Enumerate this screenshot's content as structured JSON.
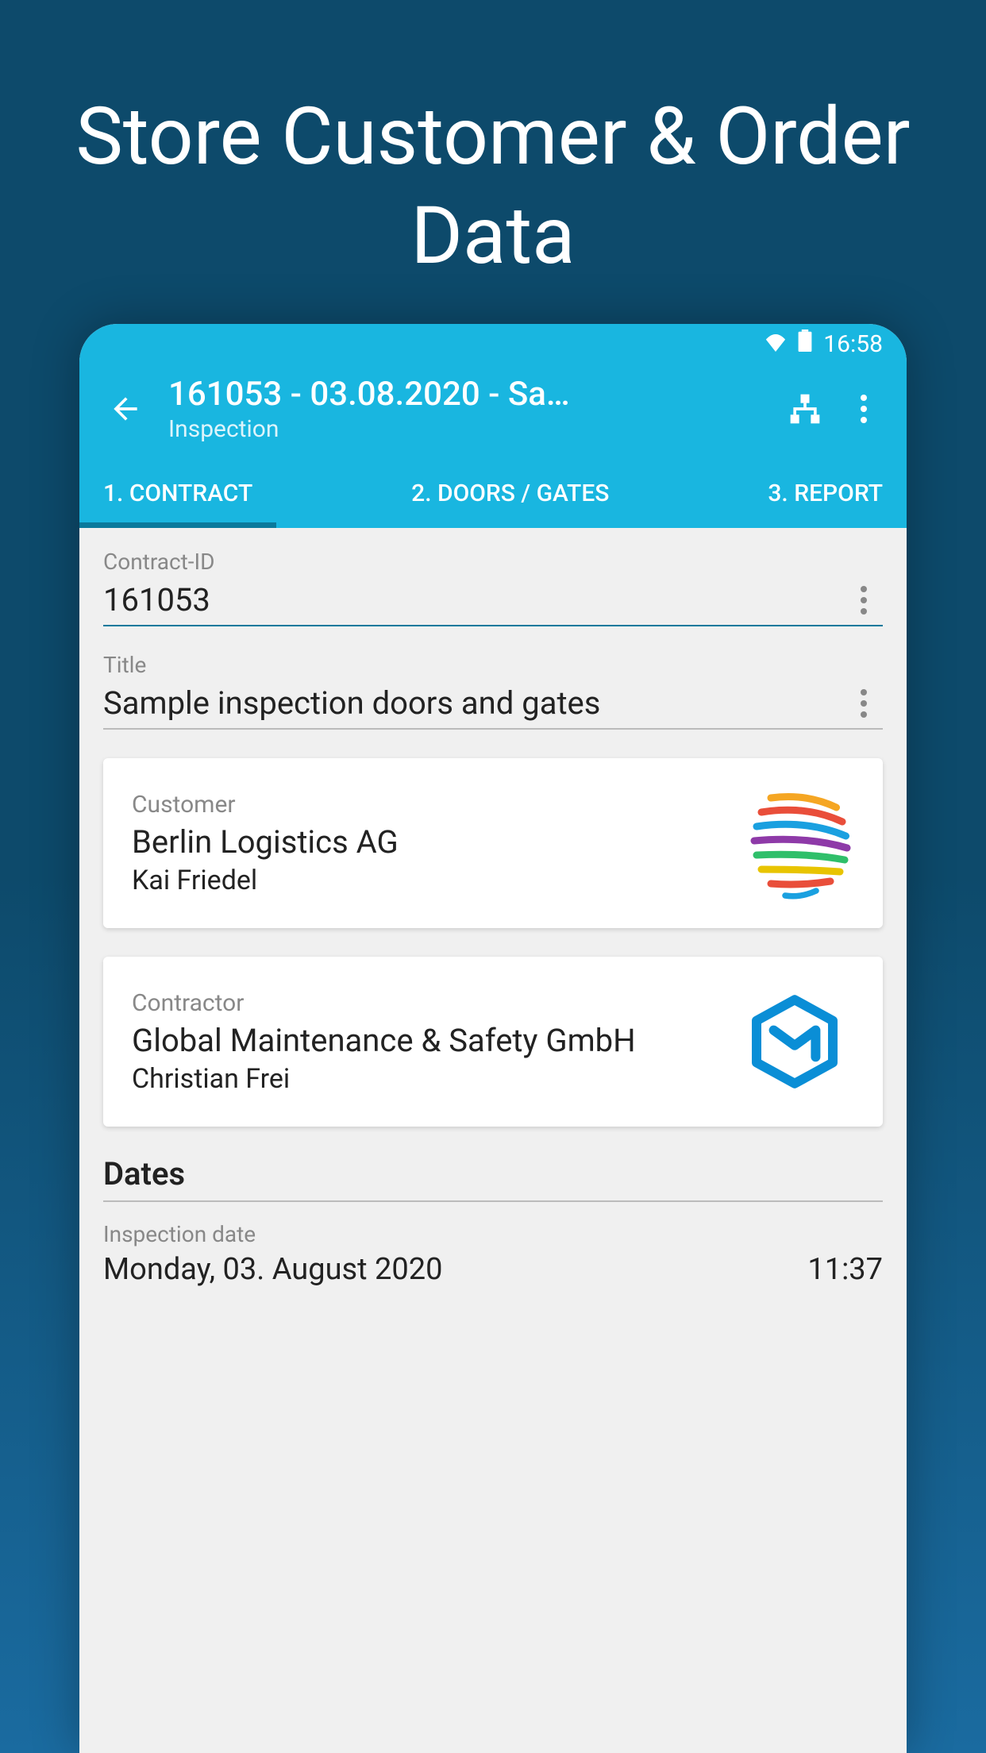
{
  "promo": {
    "title": "Store Customer & Order Data"
  },
  "statusBar": {
    "time": "16:58"
  },
  "appBar": {
    "title": "161053 - 03.08.2020 - Sa…",
    "subtitle": "Inspection"
  },
  "tabs": {
    "t1": "1. CONTRACT",
    "t2": "2. DOORS / GATES",
    "t3": "3. REPORT"
  },
  "fields": {
    "contractId": {
      "label": "Contract-ID",
      "value": "161053"
    },
    "title": {
      "label": "Title",
      "value": "Sample inspection doors and gates"
    }
  },
  "customer": {
    "label": "Customer",
    "name": "Berlin Logistics AG",
    "person": "Kai Friedel"
  },
  "contractor": {
    "label": "Contractor",
    "name": "Global Maintenance & Safety GmbH",
    "person": "Christian Frei"
  },
  "dates": {
    "heading": "Dates",
    "inspection": {
      "label": "Inspection date",
      "value": "Monday, 03. August 2020",
      "time": "11:37"
    }
  }
}
